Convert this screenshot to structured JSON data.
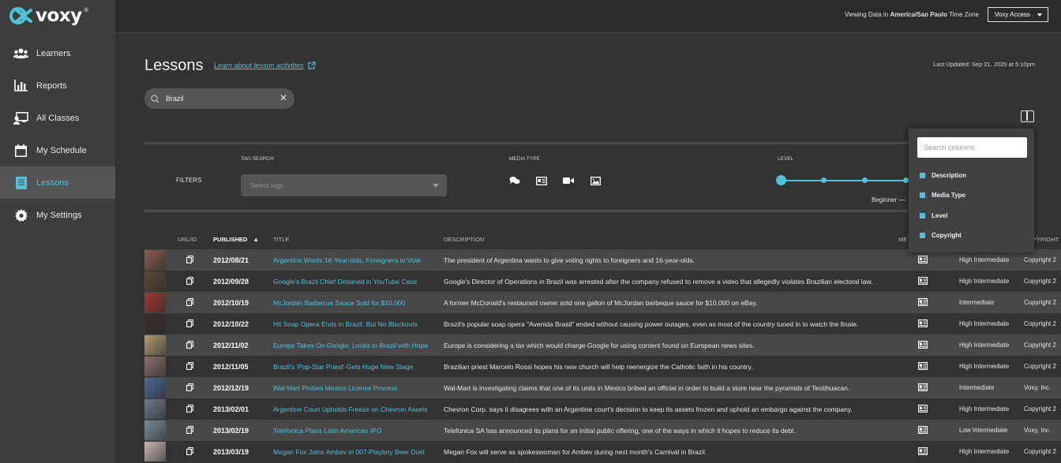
{
  "brand": {
    "logo_text": "voxy",
    "accent": "#4ec3d9"
  },
  "sidebar": {
    "items": [
      {
        "label": "Learners",
        "icon": "users-icon",
        "active": false
      },
      {
        "label": "Reports",
        "icon": "bar-chart-icon",
        "active": false
      },
      {
        "label": "All Classes",
        "icon": "classroom-icon",
        "active": false
      },
      {
        "label": "My Schedule",
        "icon": "calendar-icon",
        "active": false
      },
      {
        "label": "Lessons",
        "icon": "book-icon",
        "active": true
      },
      {
        "label": "My Settings",
        "icon": "gear-icon",
        "active": false
      }
    ]
  },
  "topbar": {
    "tz_prefix": "Viewing Data in ",
    "tz_value": "America/Sao Paulo",
    "tz_suffix": " Time Zone",
    "access_label": "Voxy Access"
  },
  "header": {
    "title": "Lessons",
    "learn_link": "Learn about lesson activities",
    "last_updated": "Last Updated: Sep 21, 2020 at 5:10pm"
  },
  "search": {
    "value": "Brazil"
  },
  "filters": {
    "label": "FILTERS",
    "tag_search_caption": "TAG SEARCH",
    "tag_placeholder": "Select tags",
    "media_caption": "MEDIA TYPE",
    "media_types": [
      "chat-icon",
      "article-icon",
      "video-icon",
      "image-icon"
    ],
    "level_caption": "LEVEL",
    "level_min_label": "Beginner —"
  },
  "table": {
    "columns": [
      "URL/ID",
      "PUBLISHED",
      "TITLE",
      "DESCRIPTION",
      "ME",
      "OPYRIGHT"
    ],
    "rows": [
      {
        "date": "2012/08/21",
        "title": "Argentina Wants 16-Year-olds, Foreigners to Vote",
        "desc": "The president of Argentina wants to give voting rights to foreigners and 16-year-olds.",
        "level": "High Intermediate",
        "copyright": "Copyright 2",
        "thumb": "#8a5a4a"
      },
      {
        "date": "2012/09/28",
        "title": "Google's Brazil Chief Detained in YouTube Case",
        "desc": "Google's Director of Operations in Brazil was arrested after the company refused to remove a video that allegedly violates Brazilian electoral law.",
        "level": "High Intermediate",
        "copyright": "Copyright 2",
        "thumb": "#5a4a3a"
      },
      {
        "date": "2012/10/19",
        "title": "McJordan Barbecue Sauce Sold for $10,000",
        "desc": "A former McDonald's restaurant owner sold one gallon of McJordan barbeque sauce for $10,000 on eBay.",
        "level": "Intermediate",
        "copyright": "Copyright 2",
        "thumb": "#a03a30"
      },
      {
        "date": "2012/10/22",
        "title": "Hit Soap Opera Ends in Brazil, But No Blackouts",
        "desc": "Brazil's popular soap opera \"Avenida Brasil\" ended without causing power outages, even as most of the country tuned in to watch the finale.",
        "level": "High Intermediate",
        "copyright": "Copyright 2",
        "thumb": "#3a2f28"
      },
      {
        "date": "2012/11/02",
        "title": "Europe Takes On Google, Looks to Brazil with Hope",
        "desc": "Europe is considering a tax which would charge Google for using content found on European news sites.",
        "level": "High Intermediate",
        "copyright": "Copyright 2",
        "thumb": "#b49a70"
      },
      {
        "date": "2012/11/05",
        "title": "Brazil's 'Pop-Star Priest' Gets Huge New Stage",
        "desc": "Brazilian priest Marcelo Rossi hopes his new church will help reenergize the Catholic faith in his country.",
        "level": "High Intermediate",
        "copyright": "Copyright 2",
        "thumb": "#8a6e6a"
      },
      {
        "date": "2012/12/19",
        "title": "Wal-Mart Probes Mexico License Process",
        "desc": "Wal-Mart is investigating claims that one of its units in Mexico bribed an official in order to build a store near the pyramids of Teotihuacan.",
        "level": "Intermediate",
        "copyright": "Voxy, Inc.",
        "thumb": "#4a6a9a"
      },
      {
        "date": "2013/02/01",
        "title": "Argentine Court Upholds Freeze on Chevron Assets",
        "desc": "Chevron Corp. says it disagrees with an Argentine court's decision to keep its assets frozen and uphold an embargo against the company.",
        "level": "High Intermediate",
        "copyright": "Copyright 2",
        "thumb": "#6a7a8a"
      },
      {
        "date": "2013/02/19",
        "title": "Telefonica Plans Latin American IPO",
        "desc": "Telefonica SA has announced its plans for an initial public offering, one of the ways in which it hopes to reduce its debt.",
        "level": "Low Intermediate",
        "copyright": "Voxy, Inc.",
        "thumb": "#7a8a9a"
      },
      {
        "date": "2013/03/19",
        "title": "Megan Fox Joins Ambev in 007-Playboy Beer Duel",
        "desc": "Megan Fox will serve as spokeswoman for Ambev during next month's Carnival in Brazil.",
        "level": "High Intermediate",
        "copyright": "Copyright 2",
        "thumb": "#c8b8b0"
      }
    ]
  },
  "column_picker": {
    "placeholder": "Search columns",
    "options": [
      "Description",
      "Media Type",
      "Level",
      "Copyright"
    ]
  }
}
